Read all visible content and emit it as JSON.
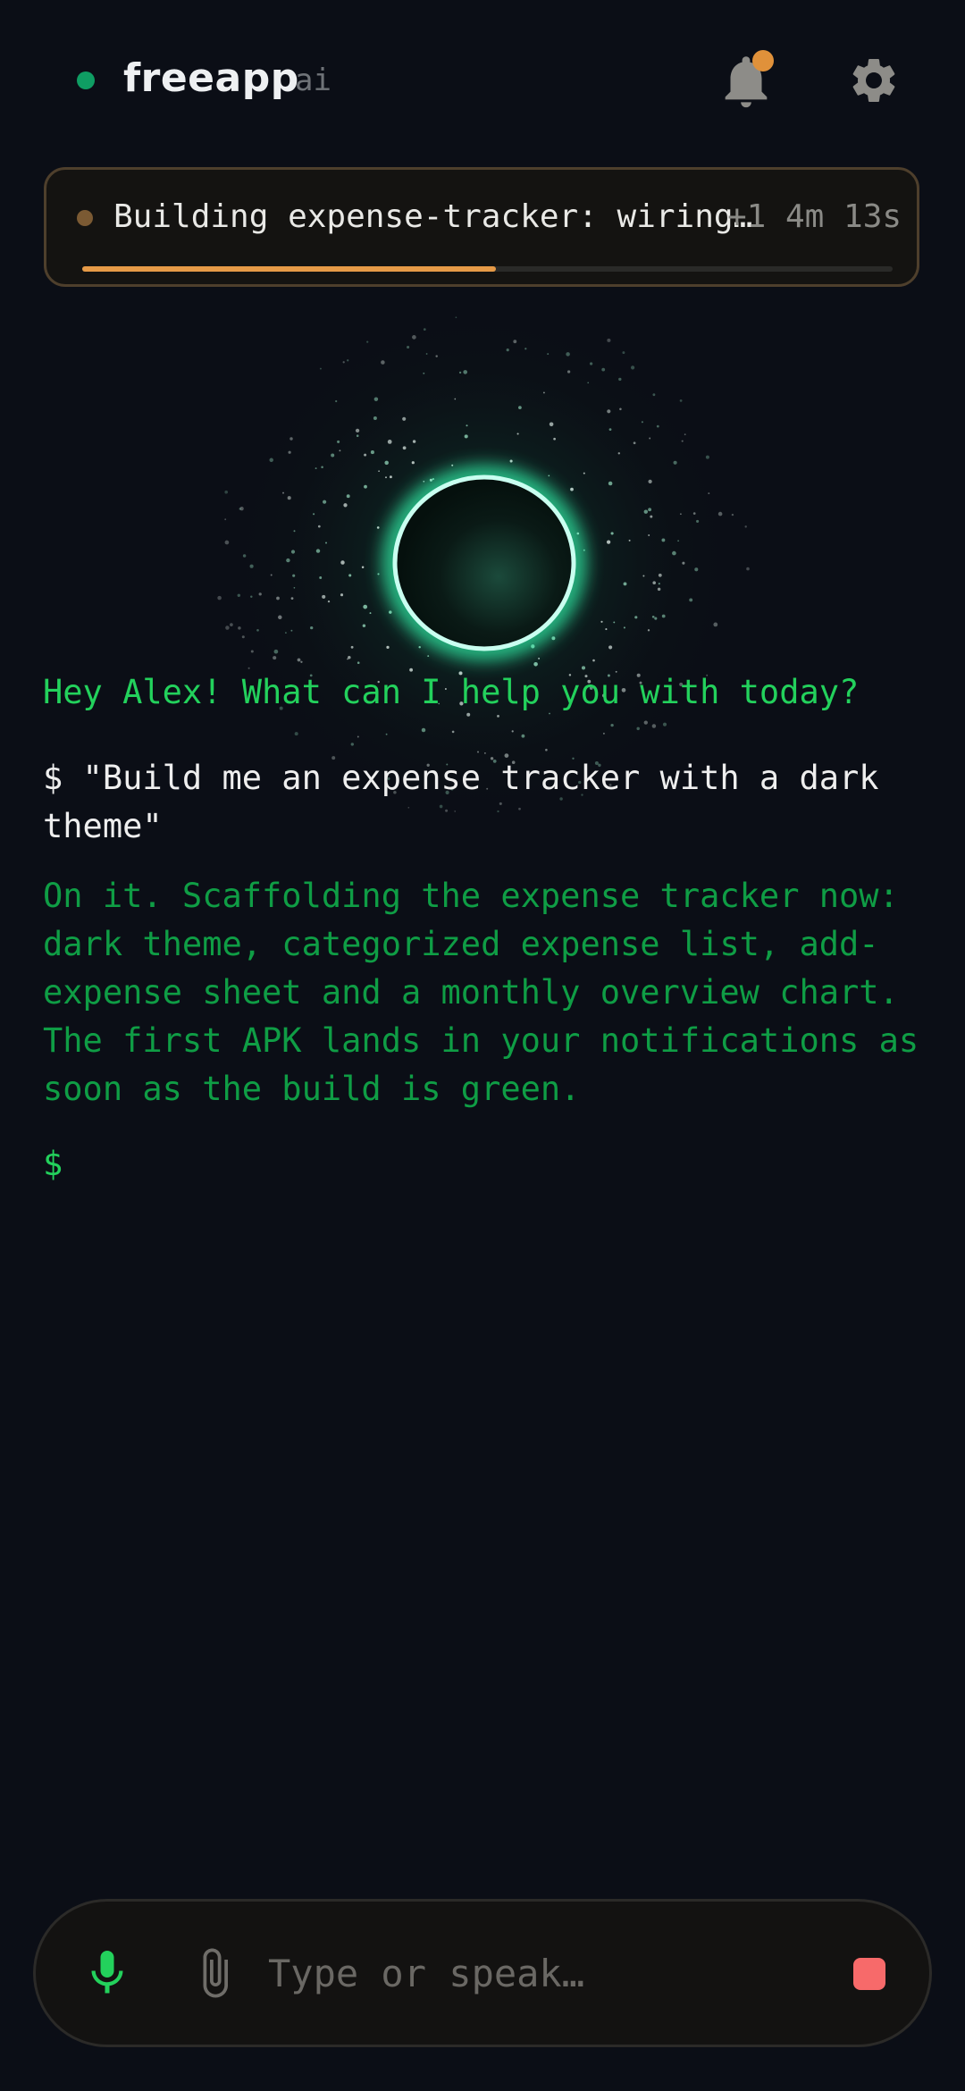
{
  "header": {
    "app_name": "freeapp",
    "app_suffix": "ai",
    "status_color": "#0f9d63",
    "notification_icon": "bell-icon",
    "notification_badge_color": "#e0913a",
    "settings_icon": "gear-icon"
  },
  "build": {
    "status_text": "Building expense-tracker: wiring…",
    "extra_count": "+1",
    "elapsed": "4m 13s",
    "progress": 0.51,
    "progress_color": "#e69a47"
  },
  "chat": {
    "greeting": "Hey Alex! What can I help you with today?",
    "user_message": "$ \"Build me an expense tracker with a dark theme\"",
    "ai_message": "On it. Scaffolding the expense tracker now: dark theme, categorized expense list, add-expense sheet and a monthly overview chart. The first APK lands in your notifications as soon as the build is green.",
    "prompt": "$"
  },
  "input": {
    "placeholder": "Type or speak…",
    "value": "",
    "mic_icon": "mic-icon",
    "attach_icon": "paperclip-icon",
    "stop_icon": "stop-icon",
    "stop_color": "#f76a6a",
    "accent": "#23d15c"
  }
}
